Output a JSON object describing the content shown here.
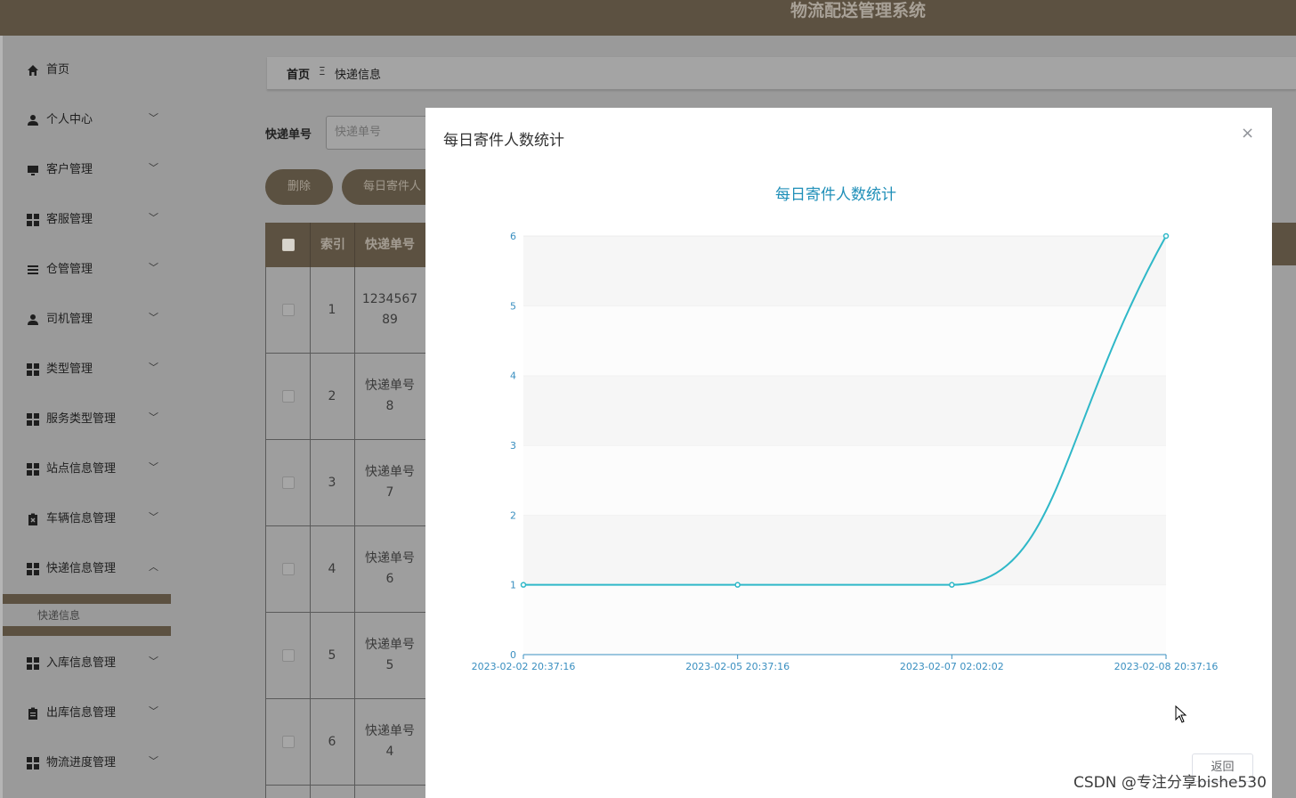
{
  "header": {
    "title": "物流配送管理系统"
  },
  "sidebar": {
    "items": [
      {
        "label": "首页",
        "icon": "home-icon",
        "expanded": false
      },
      {
        "label": "个人中心",
        "icon": "user-icon",
        "expanded": false
      },
      {
        "label": "客户管理",
        "icon": "monitor-icon",
        "expanded": false
      },
      {
        "label": "客服管理",
        "icon": "grid-icon",
        "expanded": false
      },
      {
        "label": "仓管管理",
        "icon": "list-icon",
        "expanded": false
      },
      {
        "label": "司机管理",
        "icon": "user-icon",
        "expanded": false
      },
      {
        "label": "类型管理",
        "icon": "grid-icon",
        "expanded": false
      },
      {
        "label": "服务类型管理",
        "icon": "grid-icon",
        "expanded": false
      },
      {
        "label": "站点信息管理",
        "icon": "grid-icon",
        "expanded": false
      },
      {
        "label": "车辆信息管理",
        "icon": "clipboard-x-icon",
        "expanded": false
      },
      {
        "label": "快递信息管理",
        "icon": "grid-icon",
        "expanded": true
      },
      {
        "label": "入库信息管理",
        "icon": "grid-icon",
        "expanded": false
      },
      {
        "label": "出库信息管理",
        "icon": "clipboard-icon",
        "expanded": false
      },
      {
        "label": "物流进度管理",
        "icon": "grid-icon",
        "expanded": false
      }
    ],
    "submenu": {
      "label": "快递信息"
    }
  },
  "breadcrumb": {
    "home": "首页",
    "separator": "Ξ",
    "current": "快递信息"
  },
  "search": {
    "label": "快递单号",
    "placeholder": "快递单号"
  },
  "toolbar": {
    "delete_label": "删除",
    "stats_label": "每日寄件人"
  },
  "table": {
    "headers": {
      "index": "索引",
      "tracking_no": "快递单号"
    },
    "rows": [
      {
        "index": "1",
        "no_line1": "1234567",
        "no_line2": "89"
      },
      {
        "index": "2",
        "no_line1": "快递单号",
        "no_line2": "8"
      },
      {
        "index": "3",
        "no_line1": "快递单号",
        "no_line2": "7"
      },
      {
        "index": "4",
        "no_line1": "快递单号",
        "no_line2": "6"
      },
      {
        "index": "5",
        "no_line1": "快递单号",
        "no_line2": "5"
      },
      {
        "index": "6",
        "no_line1": "快递单号",
        "no_line2": "4"
      }
    ]
  },
  "modal": {
    "title": "每日寄件人数统计",
    "close": "×",
    "return_label": "返回"
  },
  "chart_data": {
    "type": "line",
    "title": "每日寄件人数统计",
    "categories": [
      "2023-02-02 20:37:16",
      "2023-02-05 20:37:16",
      "2023-02-07 02:02:02",
      "2023-02-08 20:37:16"
    ],
    "series": [
      {
        "values": [
          1,
          1,
          1,
          6
        ]
      }
    ],
    "y_ticks": [
      "0",
      "1",
      "2",
      "3",
      "4",
      "5",
      "6"
    ],
    "ylim": [
      0,
      6
    ],
    "smooth": true,
    "grid": "alternating-bands",
    "colors": {
      "line": "#2fb8c8",
      "axis": "#3a8fc0",
      "title": "#1f8fb8"
    }
  },
  "watermark": "CSDN @专注分享bishe530"
}
